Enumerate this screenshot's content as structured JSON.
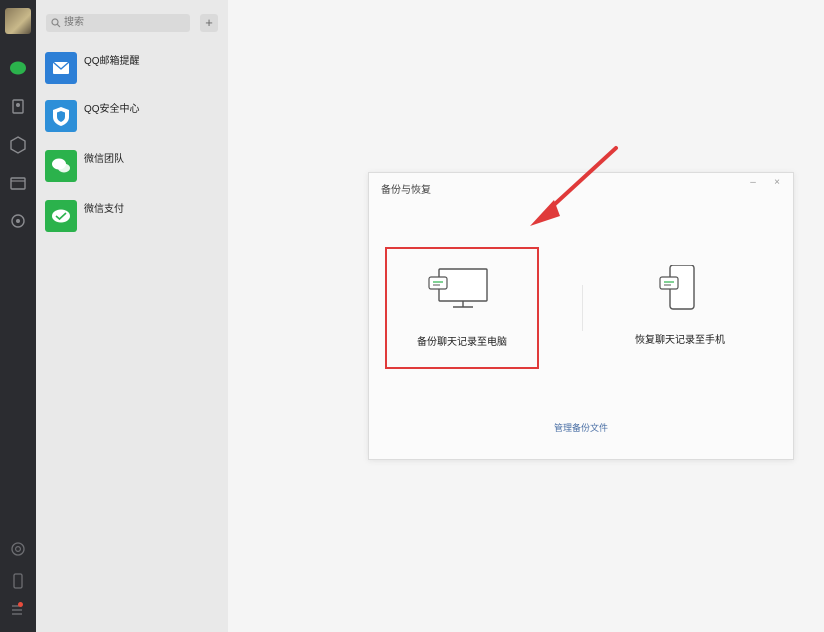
{
  "sidebar": {
    "nav_icons": [
      "chat-icon",
      "contacts-icon",
      "favorites-icon",
      "files-icon",
      "moments-icon",
      "mini-program-icon",
      "phone-icon",
      "menu-icon"
    ]
  },
  "search": {
    "placeholder": "搜索",
    "add_label": "+"
  },
  "chats": [
    {
      "name": "QQ邮箱提醒",
      "icon": "mail-icon",
      "color": "#2d7fd6"
    },
    {
      "name": "QQ安全中心",
      "icon": "shield-icon",
      "color": "#2d8fd8"
    },
    {
      "name": "微信团队",
      "icon": "wechat-icon",
      "color": "#2bb24c"
    },
    {
      "name": "微信支付",
      "icon": "wechat-pay-icon",
      "color": "#2bb24c"
    }
  ],
  "dialog": {
    "title": "备份与恢复",
    "minimize_label": "–",
    "close_label": "×",
    "option_pc_label": "备份聊天记录至电脑",
    "option_phone_label": "恢复聊天记录至手机",
    "manage_label": "管理备份文件"
  },
  "colors": {
    "highlight": "#e03a3a",
    "wechat_green": "#2bb24c",
    "rail": "#2b2c30"
  }
}
